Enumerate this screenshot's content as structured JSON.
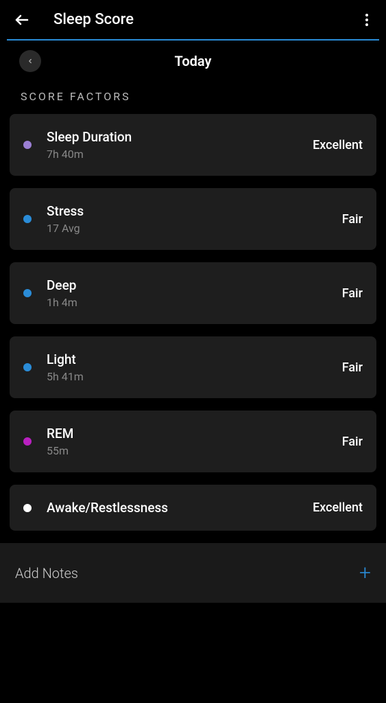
{
  "header": {
    "title": "Sleep Score"
  },
  "dateNav": {
    "label": "Today"
  },
  "section": {
    "title": "SCORE FACTORS"
  },
  "factors": [
    {
      "title": "Sleep Duration",
      "value": "7h 40m",
      "rating": "Excellent",
      "color": "#9b7fd4"
    },
    {
      "title": "Stress",
      "value": "17 Avg",
      "rating": "Fair",
      "color": "#2a8cd8"
    },
    {
      "title": "Deep",
      "value": "1h 4m",
      "rating": "Fair",
      "color": "#2a8cd8"
    },
    {
      "title": "Light",
      "value": "5h 41m",
      "rating": "Fair",
      "color": "#2a8cd8"
    },
    {
      "title": "REM",
      "value": "55m",
      "rating": "Fair",
      "color": "#b920c0"
    },
    {
      "title": "Awake/Restlessness",
      "value": "",
      "rating": "Excellent",
      "color": "#ffffff"
    }
  ],
  "notes": {
    "label": "Add Notes"
  }
}
